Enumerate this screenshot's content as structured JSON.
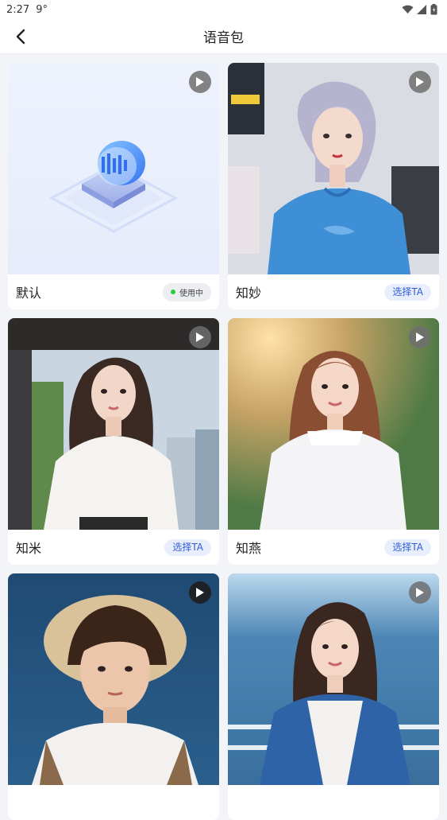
{
  "status_bar": {
    "time": "2:27",
    "temp": "9°"
  },
  "header": {
    "title": "语音包"
  },
  "colors": {
    "accent": "#2f5bd8",
    "in_use_dot": "#2ecc40",
    "background": "#f3f4f8"
  },
  "voices": [
    {
      "name": "默认",
      "state": "in_use",
      "label": "使用中",
      "image": "default-voice-illustration"
    },
    {
      "name": "知妙",
      "state": "available",
      "label": "选择TA",
      "image": "silver-hair-girl-blue-tshirt"
    },
    {
      "name": "知米",
      "state": "available",
      "label": "选择TA",
      "image": "brunette-girl-white-blouse"
    },
    {
      "name": "知燕",
      "state": "available",
      "label": "选择TA",
      "image": "girl-sunset-white-top"
    },
    {
      "name": "",
      "state": "available",
      "label": "",
      "image": "boy-bucket-hat"
    },
    {
      "name": "",
      "state": "available",
      "label": "",
      "image": "girl-braids-sea"
    }
  ]
}
